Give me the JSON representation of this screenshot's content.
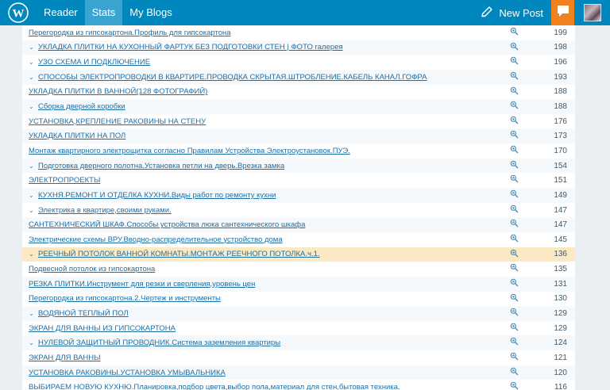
{
  "topbar": {
    "logo_icon": "wordpress-logo-icon",
    "nav": [
      {
        "label": "Reader",
        "active": false
      },
      {
        "label": "Stats",
        "active": true
      },
      {
        "label": "My Blogs",
        "active": false
      }
    ],
    "new_post_label": "New Post",
    "brand_color": "#0087be",
    "notification_color": "#f0821e"
  },
  "rows": [
    {
      "title": "Перегородка из гипсокартона.Профиль для гипсокартона",
      "chevron": false,
      "count": "199"
    },
    {
      "title": "УКЛАДКА ПЛИТКИ НА КУХОННЫЙ ФАРТУК БЕЗ ПОДГОТОВКИ СТЕН | ФОТО галерея",
      "chevron": true,
      "count": "198"
    },
    {
      "title": "УЗО СХЕМА И ПОДКЛЮЧЕНИЕ",
      "chevron": true,
      "count": "196"
    },
    {
      "title": "СПОСОБЫ ЭЛЕКТРОПРОВОДКИ В КВАРТИРЕ.ПРОВОДКА СКРЫТАЯ.ШТРОБЛЕНИЕ.КАБЕЛЬ КАНАЛ.ГОФРА",
      "chevron": true,
      "count": "193"
    },
    {
      "title": "УКЛАДКА ПЛИТКИ В ВАННОЙ(128 ФОТОГРАФИЙ)",
      "chevron": false,
      "count": "188"
    },
    {
      "title": "Сборка дверной коробки",
      "chevron": true,
      "count": "188"
    },
    {
      "title": "УСТАНОВКА,КРЕПЛЕНИЕ РАКОВИНЫ НА СТЕНУ",
      "chevron": false,
      "count": "176"
    },
    {
      "title": "УКЛАДКА ПЛИТКИ НА ПОЛ",
      "chevron": false,
      "count": "173"
    },
    {
      "title": "Монтаж квартирного электрощитка согласно Правилам Устройства Электроустановок.ПУЭ.",
      "chevron": false,
      "count": "170"
    },
    {
      "title": "Подготовка дверного полотна.Установка петли на дверь.Врезка замка",
      "chevron": true,
      "count": "154"
    },
    {
      "title": "ЭЛЕКТРОПРОЕКТЫ",
      "chevron": false,
      "count": "151"
    },
    {
      "title": "КУХНЯ.РЕМОНТ И ОТДЕЛКА КУХНИ.Виды работ по ремонту кухни",
      "chevron": true,
      "count": "149"
    },
    {
      "title": "Электрика в квартире,своими руками.",
      "chevron": true,
      "count": "147"
    },
    {
      "title": "САНТЕХНИЧЕСКИЙ ШКАФ.Способы устройства люка сантехнического шкафа",
      "chevron": false,
      "count": "147"
    },
    {
      "title": "Электрические схемы ВРУ.Вводно-распределительное устройство дома",
      "chevron": false,
      "count": "145"
    },
    {
      "title": "РЕЕЧНЫЙ ПОТОЛОК ВАННОЙ КОМНАТЫ.МОНТАЖ РЕЕЧНОГО ПОТОЛКА.ч.1.",
      "chevron": true,
      "count": "136",
      "highlight": true
    },
    {
      "title": "Подвесной потолок из гипсокартона",
      "chevron": false,
      "count": "135"
    },
    {
      "title": "РЕЗКА ПЛИТКИ.Инструмент для резки и сверления,уровень цен",
      "chevron": false,
      "count": "131"
    },
    {
      "title": "Перегородка из гипсокартона.2.Чертеж и инструменты",
      "chevron": false,
      "count": "130"
    },
    {
      "title": "ВОДЯНОЙ ТЕПЛЫЙ ПОЛ",
      "chevron": true,
      "count": "129"
    },
    {
      "title": "ЭКРАН ДЛЯ ВАННЫ ИЗ ГИПСОКАРТОНА",
      "chevron": false,
      "count": "129"
    },
    {
      "title": "НУЛЕВОЙ ЗАЩИТНЫЙ ПРОВОДНИК.Система заземления квартиры",
      "chevron": true,
      "count": "124"
    },
    {
      "title": "ЭКРАН ДЛЯ ВАННЫ",
      "chevron": false,
      "count": "121"
    },
    {
      "title": "УСТАНОВКА РАКОВИНЫ.УСТАНОВКА УМЫВАЛЬНИКА",
      "chevron": false,
      "count": "120"
    },
    {
      "title": "ВЫБИРАЕМ НОВУЮ КУХНЮ.Планировка,подбор цвета,выбор пола,материал для стен,бытовая техника.",
      "chevron": false,
      "count": "116"
    }
  ]
}
